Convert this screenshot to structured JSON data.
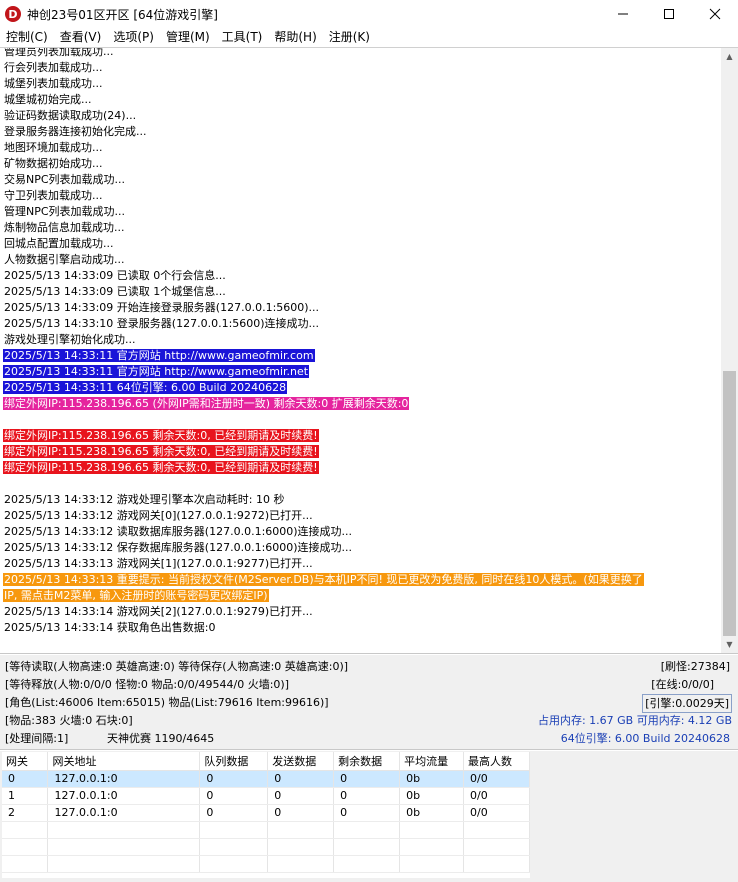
{
  "window": {
    "title": "神创23号01区开区 [64位游戏引擎]",
    "icon_letter": "D",
    "icon_color": "#c1151a"
  },
  "menu": [
    {
      "label": "控制(C)"
    },
    {
      "label": "查看(V)"
    },
    {
      "label": "选项(P)"
    },
    {
      "label": "管理(M)"
    },
    {
      "label": "工具(T)"
    },
    {
      "label": "帮助(H)"
    },
    {
      "label": "注册(K)"
    }
  ],
  "log": [
    {
      "text": "管理员列表加载成功...",
      "style": ""
    },
    {
      "text": "行会列表加载成功...",
      "style": ""
    },
    {
      "text": "城堡列表加载成功...",
      "style": ""
    },
    {
      "text": "城堡城初始完成...",
      "style": ""
    },
    {
      "text": "验证码数据读取成功(24)...",
      "style": ""
    },
    {
      "text": "登录服务器连接初始化完成...",
      "style": ""
    },
    {
      "text": "地图环境加载成功...",
      "style": ""
    },
    {
      "text": "矿物数据初始成功...",
      "style": ""
    },
    {
      "text": "交易NPC列表加载成功...",
      "style": ""
    },
    {
      "text": "守卫列表加载成功...",
      "style": ""
    },
    {
      "text": "管理NPC列表加载成功...",
      "style": ""
    },
    {
      "text": "炼制物品信息加载成功...",
      "style": ""
    },
    {
      "text": "回城点配置加载成功...",
      "style": ""
    },
    {
      "text": "人物数据引擎启动成功...",
      "style": ""
    },
    {
      "text": "2025/5/13 14:33:09 已读取 0个行会信息...",
      "style": ""
    },
    {
      "text": "2025/5/13 14:33:09 已读取 1个城堡信息...",
      "style": ""
    },
    {
      "text": "2025/5/13 14:33:09 开始连接登录服务器(127.0.0.1:5600)...",
      "style": ""
    },
    {
      "text": "2025/5/13 14:33:10 登录服务器(127.0.0.1:5600)连接成功...",
      "style": ""
    },
    {
      "text": "游戏处理引擎初始化成功...",
      "style": ""
    },
    {
      "text": "2025/5/13 14:33:11 官方网站 http://www.gameofmir.com",
      "style": "hl-blue"
    },
    {
      "text": "2025/5/13 14:33:11 官方网站 http://www.gameofmir.net",
      "style": "hl-blue"
    },
    {
      "text": "2025/5/13 14:33:11 64位引擎: 6.00 Build 20240628",
      "style": "hl-blue"
    },
    {
      "text": "绑定外网IP:115.238.196.65 (外网IP需和注册时一致) 剩余天数:0 扩展剩余天数:0",
      "style": "hl-magenta"
    },
    {
      "text": "",
      "style": ""
    },
    {
      "text": "绑定外网IP:115.238.196.65 剩余天数:0, 已经到期请及时续费!",
      "style": "hl-red"
    },
    {
      "text": "绑定外网IP:115.238.196.65 剩余天数:0, 已经到期请及时续费!",
      "style": "hl-red"
    },
    {
      "text": "绑定外网IP:115.238.196.65 剩余天数:0, 已经到期请及时续费!",
      "style": "hl-red"
    },
    {
      "text": "",
      "style": ""
    },
    {
      "text": "2025/5/13 14:33:12 游戏处理引擎本次启动耗时: 10 秒",
      "style": ""
    },
    {
      "text": "2025/5/13 14:33:12 游戏网关[0](127.0.0.1:9272)已打开...",
      "style": ""
    },
    {
      "text": "2025/5/13 14:33:12 读取数据库服务器(127.0.0.1:6000)连接成功...",
      "style": ""
    },
    {
      "text": "2025/5/13 14:33:12 保存数据库服务器(127.0.0.1:6000)连接成功...",
      "style": ""
    },
    {
      "text": "2025/5/13 14:33:13 游戏网关[1](127.0.0.1:9277)已打开...",
      "style": ""
    },
    {
      "text": "2025/5/13 14:33:13 重要提示: 当前授权文件(M2Server.DB)与本机IP不同! 现已更改为免费版, 同时在线10人模式。(如果更换了",
      "style": "hl-orange"
    },
    {
      "text": "IP, 需点击M2菜单, 输入注册时的账号密码更改绑定IP)",
      "style": "hl-orange"
    },
    {
      "text": "2025/5/13 14:33:14 游戏网关[2](127.0.0.1:9279)已打开...",
      "style": ""
    },
    {
      "text": "2025/5/13 14:33:14 获取角色出售数据:0",
      "style": ""
    }
  ],
  "status": {
    "line1_left": "[等待读取(人物高速:0 英雄高速:0) 等待保存(人物高速:0 英雄高速:0)]",
    "line1_right": "[刷怪:27384]",
    "line2_left": "[等待释放(人物:0/0/0 怪物:0 物品:0/0/49544/0 火墙:0)]",
    "line2_right": "[在线:0/0/0]",
    "line3_left": "[角色(List:46006 Item:65015) 物品(List:79616 Item:99616)]",
    "line3_right": "[引擎:0.0029天]",
    "line4_left": "[物品:383 火墙:0 石块:0]",
    "line4_right": "占用内存: 1.67 GB 可用内存: 4.12 GB",
    "line5_left_a": "[处理间隔:1]",
    "line5_left_b": "天神优赛 1190/4645",
    "line5_right": "64位引擎: 6.00 Build 20240628"
  },
  "gate_table": {
    "headers": [
      "网关",
      "网关地址",
      "队列数据",
      "发送数据",
      "剩余数据",
      "平均流量",
      "最高人数"
    ],
    "rows": [
      [
        "0",
        "127.0.0.1:0",
        "0",
        "0",
        "0",
        "0b",
        "0/0"
      ],
      [
        "1",
        "127.0.0.1:0",
        "0",
        "0",
        "0",
        "0b",
        "0/0"
      ],
      [
        "2",
        "127.0.0.1:0",
        "0",
        "0",
        "0",
        "0b",
        "0/0"
      ]
    ],
    "selected_row": 0
  }
}
